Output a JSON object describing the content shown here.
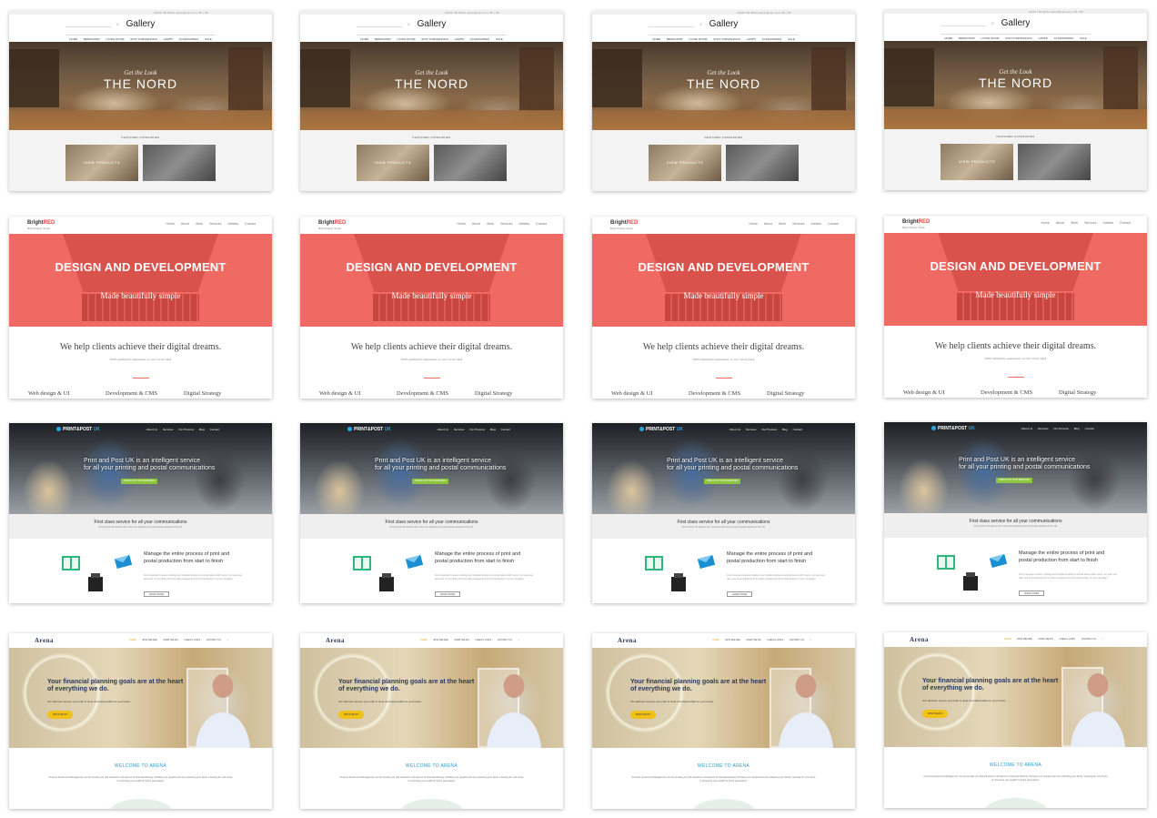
{
  "gallery": {
    "meta": "01623 750 0000  |  admin@info.com  |  FB  |  TW",
    "search_icon": "search-icon",
    "title": "Gallery",
    "nav": [
      "HOME",
      "BEDROOMS",
      "LIVING ROOM",
      "SOFT FURNISHINGS",
      "LAMPS",
      "ACCESSORIES",
      "SALE"
    ],
    "hero_sub": "Get the Look",
    "hero_title": "THE NORD",
    "featured_title": "FEATURED CATEGORIES",
    "thumb1_label": "VIEW PRODUCTS",
    "thumb2_label": ""
  },
  "brightred": {
    "logo_a": "Bright",
    "logo_b": "RED",
    "tagline": "Bright thinking, Simple",
    "nav": [
      "Home",
      "About",
      "Work",
      "Services",
      "Articles",
      "Contact"
    ],
    "hero_title": "DESIGN AND DEVELOPMENT",
    "hero_sub": "Made beautifully simple",
    "help": "We help clients achieve their digital dreams.",
    "small": "100% satisfaction guaranteed, or your money back",
    "services": [
      "Web design & UI",
      "Development & CMS",
      "Digital Strategy"
    ]
  },
  "printpost": {
    "logo_a": "PRINT",
    "logo_b": "&POST",
    "logo_c": "UK",
    "nav": [
      "About Us",
      "Services",
      "Our Process",
      "Blog",
      "Contact"
    ],
    "hero_line1": "Print and Post UK is an intelligent service",
    "hero_line2": "for all your printing and postal communications",
    "hero_button": "CHECK OUT OUR SERVICES",
    "band_title": "First class service for all your communications",
    "band_sub": "Print & Post UK delivers the most cost-effective print and postal solutions in the UK",
    "body_title": "Manage the entire process of print and postal production from start to finish",
    "body_text": "From bespoke business mailings and multiple booklets to simple letters with inserts, our team can take care of everything from the data management to the final delivery of your campaign.",
    "more_button": "LEARN MORE"
  },
  "arena": {
    "logo": "Arena",
    "nav": [
      "HOME",
      "WHO WE ARE",
      "WHAT WE DO",
      "USEFUL LINKS",
      "CONTACT US"
    ],
    "search_icon": "search-icon",
    "hero_title": "Your financial planning goals are at the heart of everything we do.",
    "hero_sub": "Our advisers ensure your plan is clear and deliverable for your future.",
    "hero_button": "WHAT WE DO",
    "welcome": "WELCOME TO ARENA",
    "welcome_text": "At Arena Investment Management, we can provide you with solutions to all aspects of financial planning. Perhaps your requirements are protecting your family, investing for your future or protecting your wealth for future generations."
  }
}
